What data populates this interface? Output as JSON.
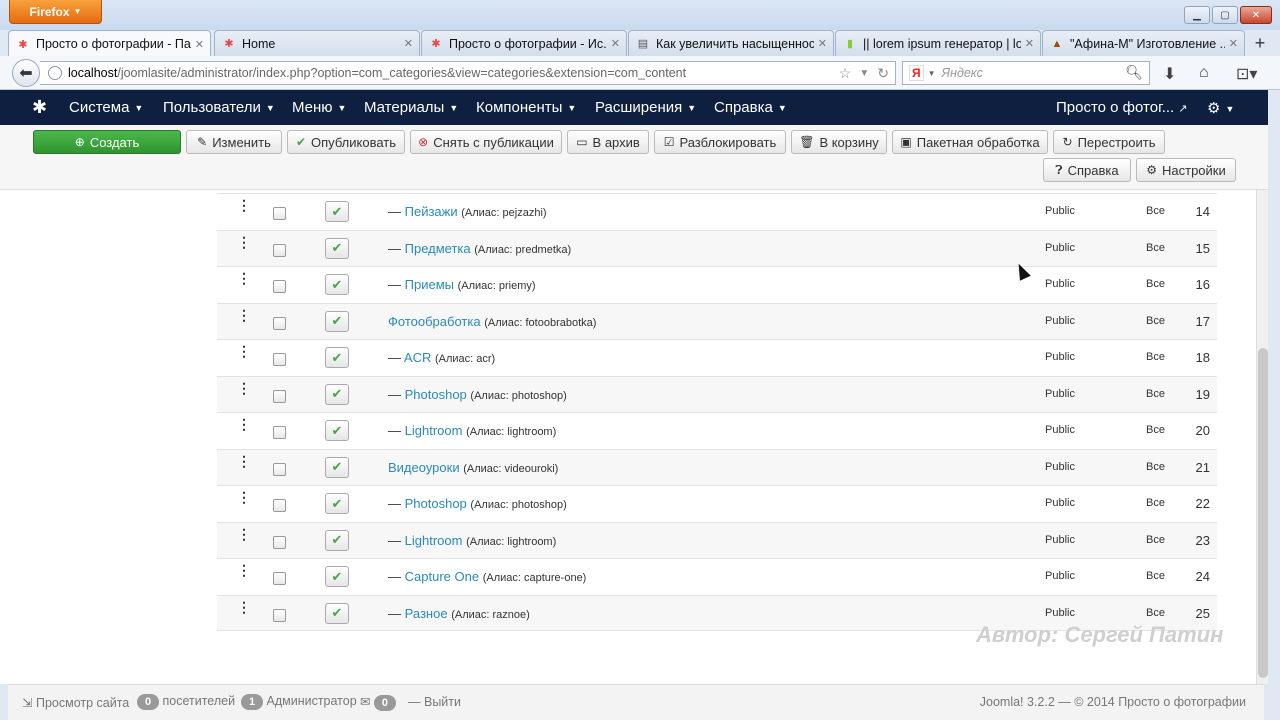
{
  "browser": {
    "menu_button": "Firefox",
    "tabs": [
      {
        "title": "Просто о фотографии - Па...",
        "active": true
      },
      {
        "title": "Home",
        "active": false
      },
      {
        "title": "Просто о фотографии - Ис...",
        "active": false
      },
      {
        "title": "Как увеличить насыщеннос...",
        "active": false
      },
      {
        "title": "|| lorem ipsum генератор | lo...",
        "active": false
      },
      {
        "title": "\"Афина-М\" Изготовление ...",
        "active": false
      }
    ],
    "url_host": "localhost",
    "url_path": "/joomlasite/administrator/index.php?option=com_categories&view=categories&extension=com_content",
    "search_engine": "Я",
    "search_placeholder": "Яндекс"
  },
  "nav": {
    "items": [
      "Система",
      "Пользователи",
      "Меню",
      "Материалы",
      "Компоненты",
      "Расширения",
      "Справка"
    ],
    "site_name": "Просто о фотог..."
  },
  "toolbar": {
    "create": "Создать",
    "edit": "Изменить",
    "publish": "Опубликовать",
    "unpublish": "Снять с публикации",
    "archive": "В архив",
    "checkin": "Разблокировать",
    "trash": "В корзину",
    "batch": "Пакетная обработка",
    "rebuild": "Перестроить",
    "help": "Справка",
    "options": "Настройки"
  },
  "categories": [
    {
      "dash": "— ",
      "title": "Пейзажи",
      "alias": "(Алиас: pejzazhi)",
      "access": "Public",
      "language": "Все",
      "id": "14"
    },
    {
      "dash": "— ",
      "title": "Предметка",
      "alias": "(Алиас: predmetka)",
      "access": "Public",
      "language": "Все",
      "id": "15"
    },
    {
      "dash": "— ",
      "title": "Приемы",
      "alias": "(Алиас: priemy)",
      "access": "Public",
      "language": "Все",
      "id": "16"
    },
    {
      "dash": "",
      "title": "Фотообработка",
      "alias": "(Алиас: fotoobrabotka)",
      "access": "Public",
      "language": "Все",
      "id": "17"
    },
    {
      "dash": "— ",
      "title": "ACR",
      "alias": "(Алиас: acr)",
      "access": "Public",
      "language": "Все",
      "id": "18"
    },
    {
      "dash": "— ",
      "title": "Photoshop",
      "alias": "(Алиас: photoshop)",
      "access": "Public",
      "language": "Все",
      "id": "19"
    },
    {
      "dash": "— ",
      "title": "Lightroom",
      "alias": "(Алиас: lightroom)",
      "access": "Public",
      "language": "Все",
      "id": "20"
    },
    {
      "dash": "",
      "title": "Видеоуроки",
      "alias": "(Алиас: videouroki)",
      "access": "Public",
      "language": "Все",
      "id": "21"
    },
    {
      "dash": "— ",
      "title": "Photoshop",
      "alias": "(Алиас: photoshop)",
      "access": "Public",
      "language": "Все",
      "id": "22"
    },
    {
      "dash": "— ",
      "title": "Lightroom",
      "alias": "(Алиас: lightroom)",
      "access": "Public",
      "language": "Все",
      "id": "23"
    },
    {
      "dash": "— ",
      "title": "Capture One",
      "alias": "(Алиас: capture-one)",
      "access": "Public",
      "language": "Все",
      "id": "24"
    },
    {
      "dash": "— ",
      "title": "Разное",
      "alias": "(Алиас: raznoe)",
      "access": "Public",
      "language": "Все",
      "id": "25"
    }
  ],
  "watermark": "Автор: Сергей Патин",
  "status": {
    "view_site": "Просмотр сайта",
    "visitors_count": "0",
    "visitors_label": "посетителей",
    "admins_count": "1",
    "admins_label": "Администратор",
    "messages_count": "0",
    "logout": "Выйти",
    "footer": "Joomla! 3.2.2 — © 2014 Просто о фотографии"
  },
  "colors": {
    "nav_bg": "#0f1f3f",
    "create_green": "#3da23d",
    "link_blue": "#2a8ab8",
    "publish_check": "#46a546"
  }
}
